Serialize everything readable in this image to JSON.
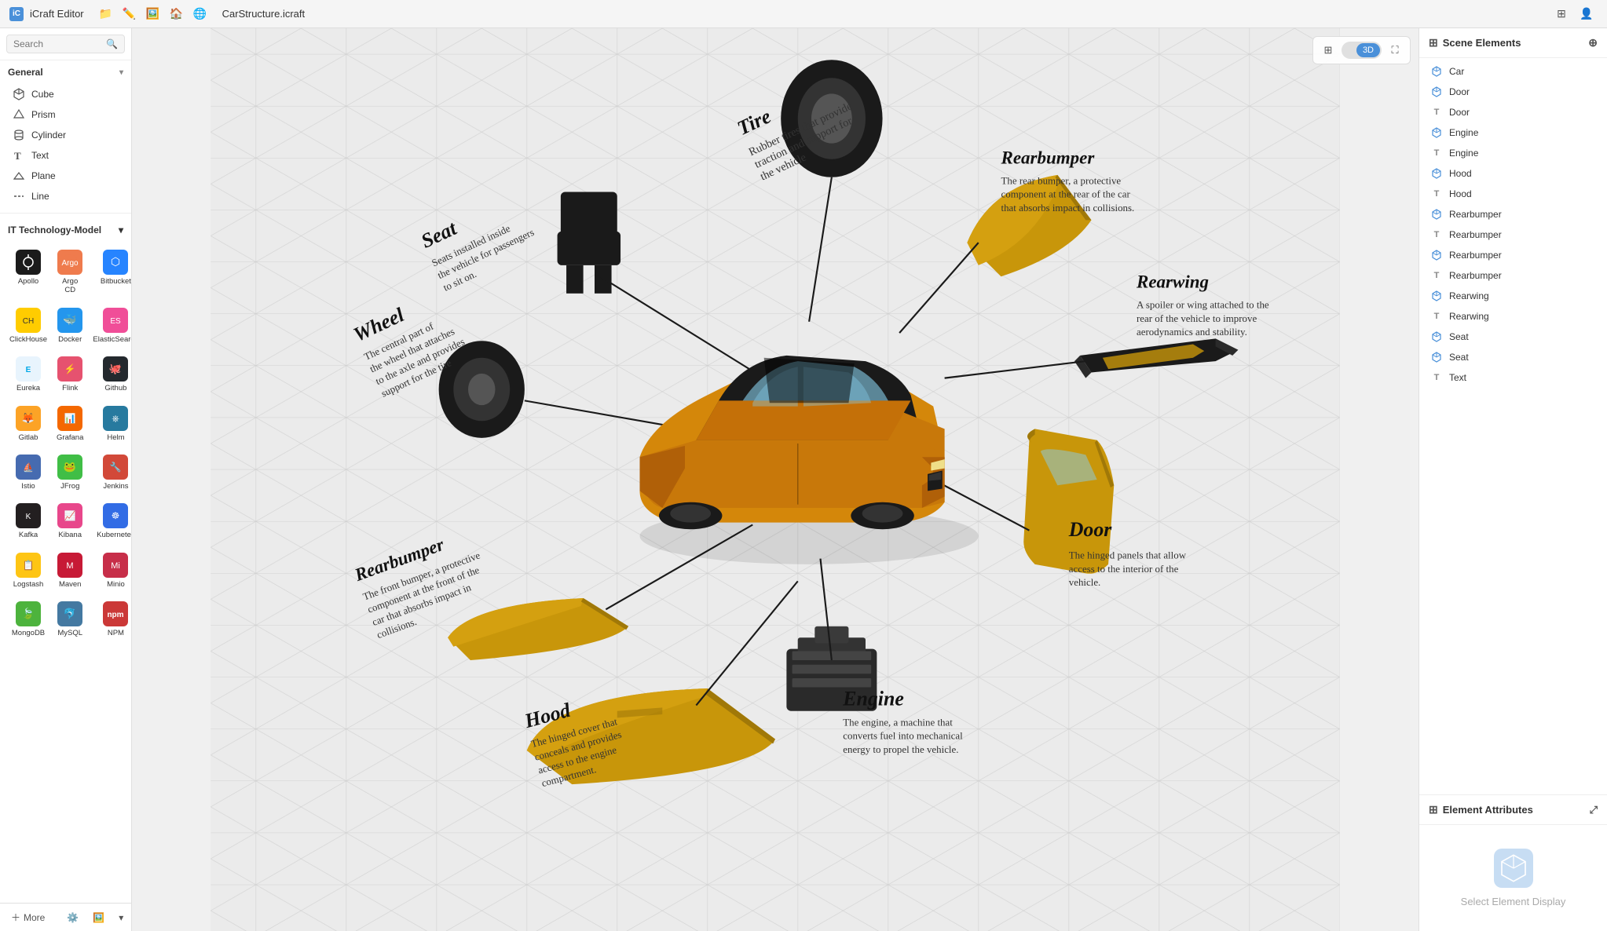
{
  "titlebar": {
    "app_name": "iCraft Editor",
    "filename": "CarStructure.icraft",
    "tools": [
      "folder-icon",
      "pen-icon",
      "image-icon",
      "home-icon",
      "globe-icon"
    ]
  },
  "search": {
    "placeholder": "Search"
  },
  "general_section": {
    "label": "General",
    "items": [
      {
        "id": "cube",
        "label": "Cube",
        "icon": "cube"
      },
      {
        "id": "prism",
        "label": "Prism",
        "icon": "prism"
      },
      {
        "id": "cylinder",
        "label": "Cylinder",
        "icon": "cylinder"
      },
      {
        "id": "text",
        "label": "Text",
        "icon": "text"
      },
      {
        "id": "plane",
        "label": "Plane",
        "icon": "plane"
      },
      {
        "id": "line",
        "label": "Line",
        "icon": "line"
      }
    ]
  },
  "it_section": {
    "label": "IT Technology-Model",
    "items": [
      {
        "id": "apollo",
        "label": "Apollo",
        "color": "#000",
        "emoji": "🔵"
      },
      {
        "id": "argocd",
        "label": "Argo CD",
        "color": "#ef7b4d",
        "emoji": "🟠"
      },
      {
        "id": "bitbucket",
        "label": "Bitbucket",
        "color": "#2684ff",
        "emoji": "🔷"
      },
      {
        "id": "clickhouse",
        "label": "ClickHouse",
        "color": "#ffcc00",
        "emoji": "🟡"
      },
      {
        "id": "docker",
        "label": "Docker",
        "color": "#2496ed",
        "emoji": "🐳"
      },
      {
        "id": "elasticsearch",
        "label": "ElasticSearch",
        "color": "#f04e98",
        "emoji": "🔍"
      },
      {
        "id": "eureka",
        "label": "Eureka",
        "color": "#00a8e8",
        "emoji": "🔵"
      },
      {
        "id": "flink",
        "label": "Flink",
        "color": "#e6526f",
        "emoji": "⚡"
      },
      {
        "id": "github",
        "label": "Github",
        "color": "#24292e",
        "emoji": "🐙"
      },
      {
        "id": "gitlab",
        "label": "Gitlab",
        "color": "#fc6d26",
        "emoji": "🦊"
      },
      {
        "id": "grafana",
        "label": "Grafana",
        "color": "#f46800",
        "emoji": "📊"
      },
      {
        "id": "helm",
        "label": "Helm",
        "color": "#277a9f",
        "emoji": "⎈"
      },
      {
        "id": "istio",
        "label": "Istio",
        "color": "#466bb0",
        "emoji": "🕸️"
      },
      {
        "id": "jfrog",
        "label": "JFrog",
        "color": "#40be46",
        "emoji": "🐸"
      },
      {
        "id": "jenkins",
        "label": "Jenkins",
        "color": "#d24939",
        "emoji": "🔧"
      },
      {
        "id": "kafka",
        "label": "Kafka",
        "color": "#231f20",
        "emoji": "📨"
      },
      {
        "id": "kibana",
        "label": "Kibana",
        "color": "#e8478b",
        "emoji": "📈"
      },
      {
        "id": "kubernetes",
        "label": "Kubernetes",
        "color": "#326ce5",
        "emoji": "☸️"
      },
      {
        "id": "logstash",
        "label": "Logstash",
        "color": "#fec514",
        "emoji": "📋"
      },
      {
        "id": "maven",
        "label": "Maven",
        "color": "#c71a36",
        "emoji": "🅼"
      },
      {
        "id": "minio",
        "label": "Minio",
        "color": "#c72e49",
        "emoji": "🗄️"
      },
      {
        "id": "mongodb",
        "label": "MongoDB",
        "color": "#4db33d",
        "emoji": "🍃"
      },
      {
        "id": "mysql",
        "label": "MySQL",
        "color": "#4479a1",
        "emoji": "🐬"
      },
      {
        "id": "npm",
        "label": "NPM",
        "color": "#cb3837",
        "emoji": "📦"
      }
    ]
  },
  "bottom_toolbar": {
    "more_label": "More",
    "buttons": [
      "settings-icon",
      "image-icon",
      "chevron-down-icon",
      "text-icon",
      "dots-icon"
    ]
  },
  "canvas": {
    "view_grid": "⊞",
    "view_toggle_off": "",
    "view_3d": "3D",
    "fullscreen_icon": "⛶",
    "labels": {
      "tire": "Tire",
      "tire_desc": "Rubber tires that provide traction and support for the vehicle",
      "seat": "Seat",
      "seat_desc": "Seats installed inside the vehicle for passengers to sit on.",
      "wheel": "Wheel",
      "wheel_desc": "The central part of the wheel that attaches to the axle and provides support for the tire",
      "rearbumper_front": "Rearbumper",
      "rearbumper_front_desc": "The front bumper, a protective component at the front of the car that absorbs impact in collisions.",
      "hood": "Hood",
      "hood_desc": "The hinged cover that conceals and provides access to the engine compartment.",
      "engine": "Engine",
      "engine_desc": "The engine, a machine that converts fuel into mechanical energy to propel the vehicle.",
      "door": "Door",
      "door_desc": "The hinged panels that allow access to the interior of the vehicle.",
      "rearbumper_rear": "Rearbumper",
      "rearbumper_rear_desc": "The rear bumper, a protective component at the rear of the car that absorbs impact in collisions.",
      "rearwing": "Rearwing",
      "rearwing_desc": "A spoiler or wing attached to the rear of the vehicle to improve aerodynamics and stability."
    }
  },
  "scene_elements": {
    "header": "Scene Elements",
    "items": [
      {
        "id": "car",
        "label": "Car",
        "type": "cube"
      },
      {
        "id": "door1",
        "label": "Door",
        "type": "cube"
      },
      {
        "id": "door2",
        "label": "Door",
        "type": "text"
      },
      {
        "id": "engine1",
        "label": "Engine",
        "type": "cube"
      },
      {
        "id": "engine2",
        "label": "Engine",
        "type": "text"
      },
      {
        "id": "hood1",
        "label": "Hood",
        "type": "cube"
      },
      {
        "id": "hood2",
        "label": "Hood",
        "type": "text"
      },
      {
        "id": "rearbumper1",
        "label": "Rearbumper",
        "type": "cube"
      },
      {
        "id": "rearbumper2",
        "label": "Rearbumper",
        "type": "text"
      },
      {
        "id": "rearbumper3",
        "label": "Rearbumper",
        "type": "cube"
      },
      {
        "id": "rearbumper4",
        "label": "Rearbumper",
        "type": "text"
      },
      {
        "id": "rearwing1",
        "label": "Rearwing",
        "type": "cube"
      },
      {
        "id": "rearwing2",
        "label": "Rearwing",
        "type": "text"
      },
      {
        "id": "seat1",
        "label": "Seat",
        "type": "cube"
      },
      {
        "id": "seat2",
        "label": "Seat",
        "type": "cube"
      },
      {
        "id": "text1",
        "label": "Text",
        "type": "text"
      }
    ]
  },
  "element_attributes": {
    "header": "Element Attributes",
    "empty_text": "Select Element Display"
  }
}
